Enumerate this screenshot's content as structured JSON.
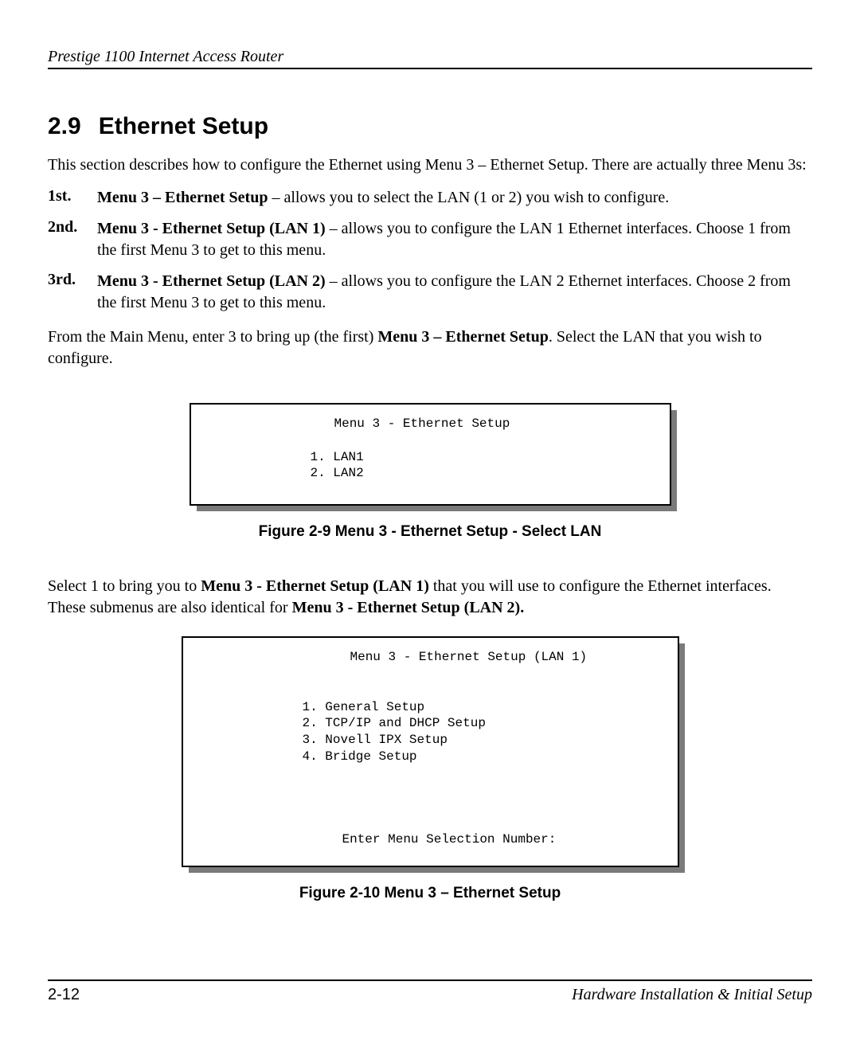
{
  "header": {
    "title": "Prestige 1100 Internet Access Router"
  },
  "section": {
    "number": "2.9",
    "title": "Ethernet Setup"
  },
  "intro": "This section describes how to configure the Ethernet using Menu 3 – Ethernet Setup.  There are actually three Menu 3s:",
  "list": {
    "items": [
      {
        "ord": "1st.",
        "bold": "Menu 3 – Ethernet Setup",
        "rest": " – allows you to select the LAN (1 or 2) you wish to configure."
      },
      {
        "ord": "2nd.",
        "bold": "Menu 3 - Ethernet Setup (LAN 1)",
        "rest": " – allows you to configure the LAN 1 Ethernet interfaces. Choose 1 from the first Menu 3 to get to this menu."
      },
      {
        "ord": "3rd.",
        "bold": "Menu 3 - Ethernet Setup (LAN 2)",
        "rest": " – allows you to configure the LAN 2 Ethernet interfaces. Choose 2 from the first Menu 3 to get to this menu."
      }
    ]
  },
  "afterList": {
    "pre": "From the Main Menu, enter 3 to bring up (the first) ",
    "bold": "Menu 3 – Ethernet Setup",
    "post": ". Select the LAN that you wish to configure."
  },
  "menuBox1": {
    "title": "Menu 3 - Ethernet Setup",
    "line1": "1. LAN1",
    "line2": "2. LAN2"
  },
  "caption1": "Figure 2-9 Menu 3 - Ethernet Setup - Select LAN",
  "midPara": {
    "pre": "Select 1 to bring you to ",
    "bold1": "Menu 3 - Ethernet Setup (LAN 1)",
    "mid": " that you will use to configure the Ethernet interfaces. These submenus are also identical for ",
    "bold2": "Menu 3 - Ethernet Setup (LAN 2)."
  },
  "menuBox2": {
    "title": "Menu 3 - Ethernet Setup (LAN 1)",
    "line1": "1. General Setup",
    "line2": "2. TCP/IP and DHCP Setup",
    "line3": "3. Novell IPX Setup",
    "line4": "4. Bridge Setup",
    "prompt": "Enter Menu Selection Number:"
  },
  "caption2": "Figure 2-10 Menu 3 – Ethernet Setup",
  "footer": {
    "left": "2-12",
    "right": "Hardware Installation & Initial Setup"
  }
}
